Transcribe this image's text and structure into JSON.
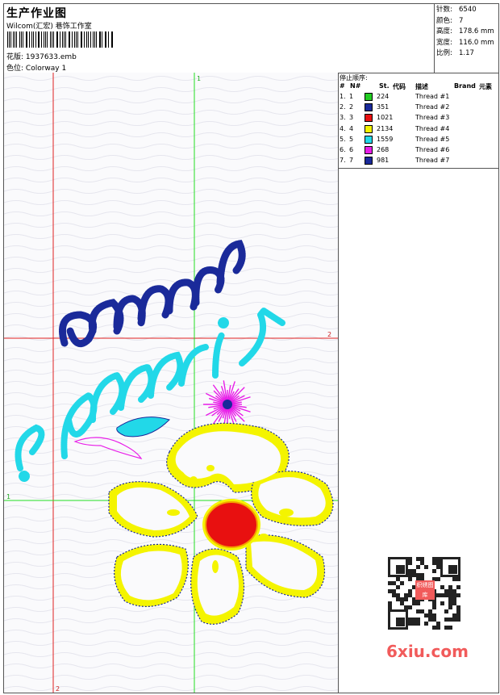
{
  "header": {
    "title": "生产作业图",
    "company": "Wilcom(汇宏) 巷饰工作室",
    "design_label": "花版:",
    "design_value": "1937633.emb",
    "colorway_label": "色位:",
    "colorway_value": "Colorway 1"
  },
  "stats": [
    {
      "label": "针数:",
      "value": "6540"
    },
    {
      "label": "颜色:",
      "value": "7"
    },
    {
      "label": "高度:",
      "value": "178.6 mm"
    },
    {
      "label": "宽度:",
      "value": "116.0 mm"
    },
    {
      "label": "比例:",
      "value": "1.17"
    }
  ],
  "stop_sequence": {
    "caption": "停止顺序:",
    "headers": [
      "#",
      "N#",
      "St.",
      "代码",
      "描述",
      "Brand",
      "元素"
    ],
    "rows": [
      {
        "num": "1.",
        "n": "1",
        "color": "#22cc22",
        "stitches": "224",
        "desc": "Thread #1"
      },
      {
        "num": "2.",
        "n": "2",
        "color": "#1a2a9a",
        "stitches": "351",
        "desc": "Thread #2"
      },
      {
        "num": "3.",
        "n": "3",
        "color": "#e81010",
        "stitches": "1021",
        "desc": "Thread #3"
      },
      {
        "num": "4.",
        "n": "4",
        "color": "#f4f400",
        "stitches": "2134",
        "desc": "Thread #4"
      },
      {
        "num": "5.",
        "n": "5",
        "color": "#22d8e8",
        "stitches": "1559",
        "desc": "Thread #5"
      },
      {
        "num": "6.",
        "n": "6",
        "color": "#e81ee8",
        "stitches": "268",
        "desc": "Thread #6"
      },
      {
        "num": "7.",
        "n": "7",
        "color": "#1a2a9a",
        "stitches": "981",
        "desc": "Thread #7"
      }
    ]
  },
  "canvas": {
    "guide_labels": [
      "1",
      "2",
      "1",
      "2"
    ],
    "guide_colors": {
      "vertical_1": "#22dd22",
      "horizontal_1": "#22dd22",
      "vertical_2": "#e02020",
      "horizontal_2": "#e02020"
    }
  },
  "watermark": "6xiu.com",
  "qr_badge": "织绣图库"
}
